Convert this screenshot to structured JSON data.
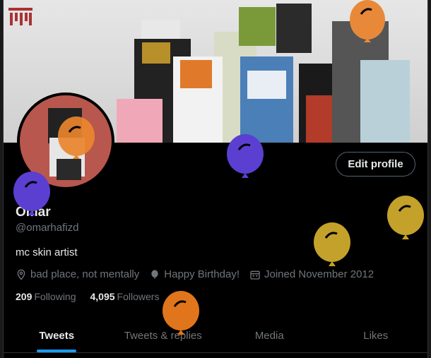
{
  "profile": {
    "name": "Omar",
    "handle": "@omarhafizd",
    "bio": "mc skin artist",
    "location": "bad place, not mentally",
    "website": "Happy Birthday!",
    "joined": "Joined November 2012",
    "following_count": "209",
    "following_label": "Following",
    "followers_count": "4,095",
    "followers_label": "Followers"
  },
  "actions": {
    "edit_profile": "Edit profile"
  },
  "tabs": [
    {
      "label": "Tweets"
    },
    {
      "label": "Tweets & replies"
    },
    {
      "label": "Media"
    },
    {
      "label": "Likes"
    }
  ],
  "colors": {
    "accent": "#1d9bf0",
    "balloon_purple": "#5b3fd1",
    "balloon_yellow": "#c4a12a",
    "balloon_orange": "#e0751c"
  },
  "icons": [
    "location-icon",
    "balloon-icon",
    "calendar-icon",
    "banner-logo-icon"
  ]
}
